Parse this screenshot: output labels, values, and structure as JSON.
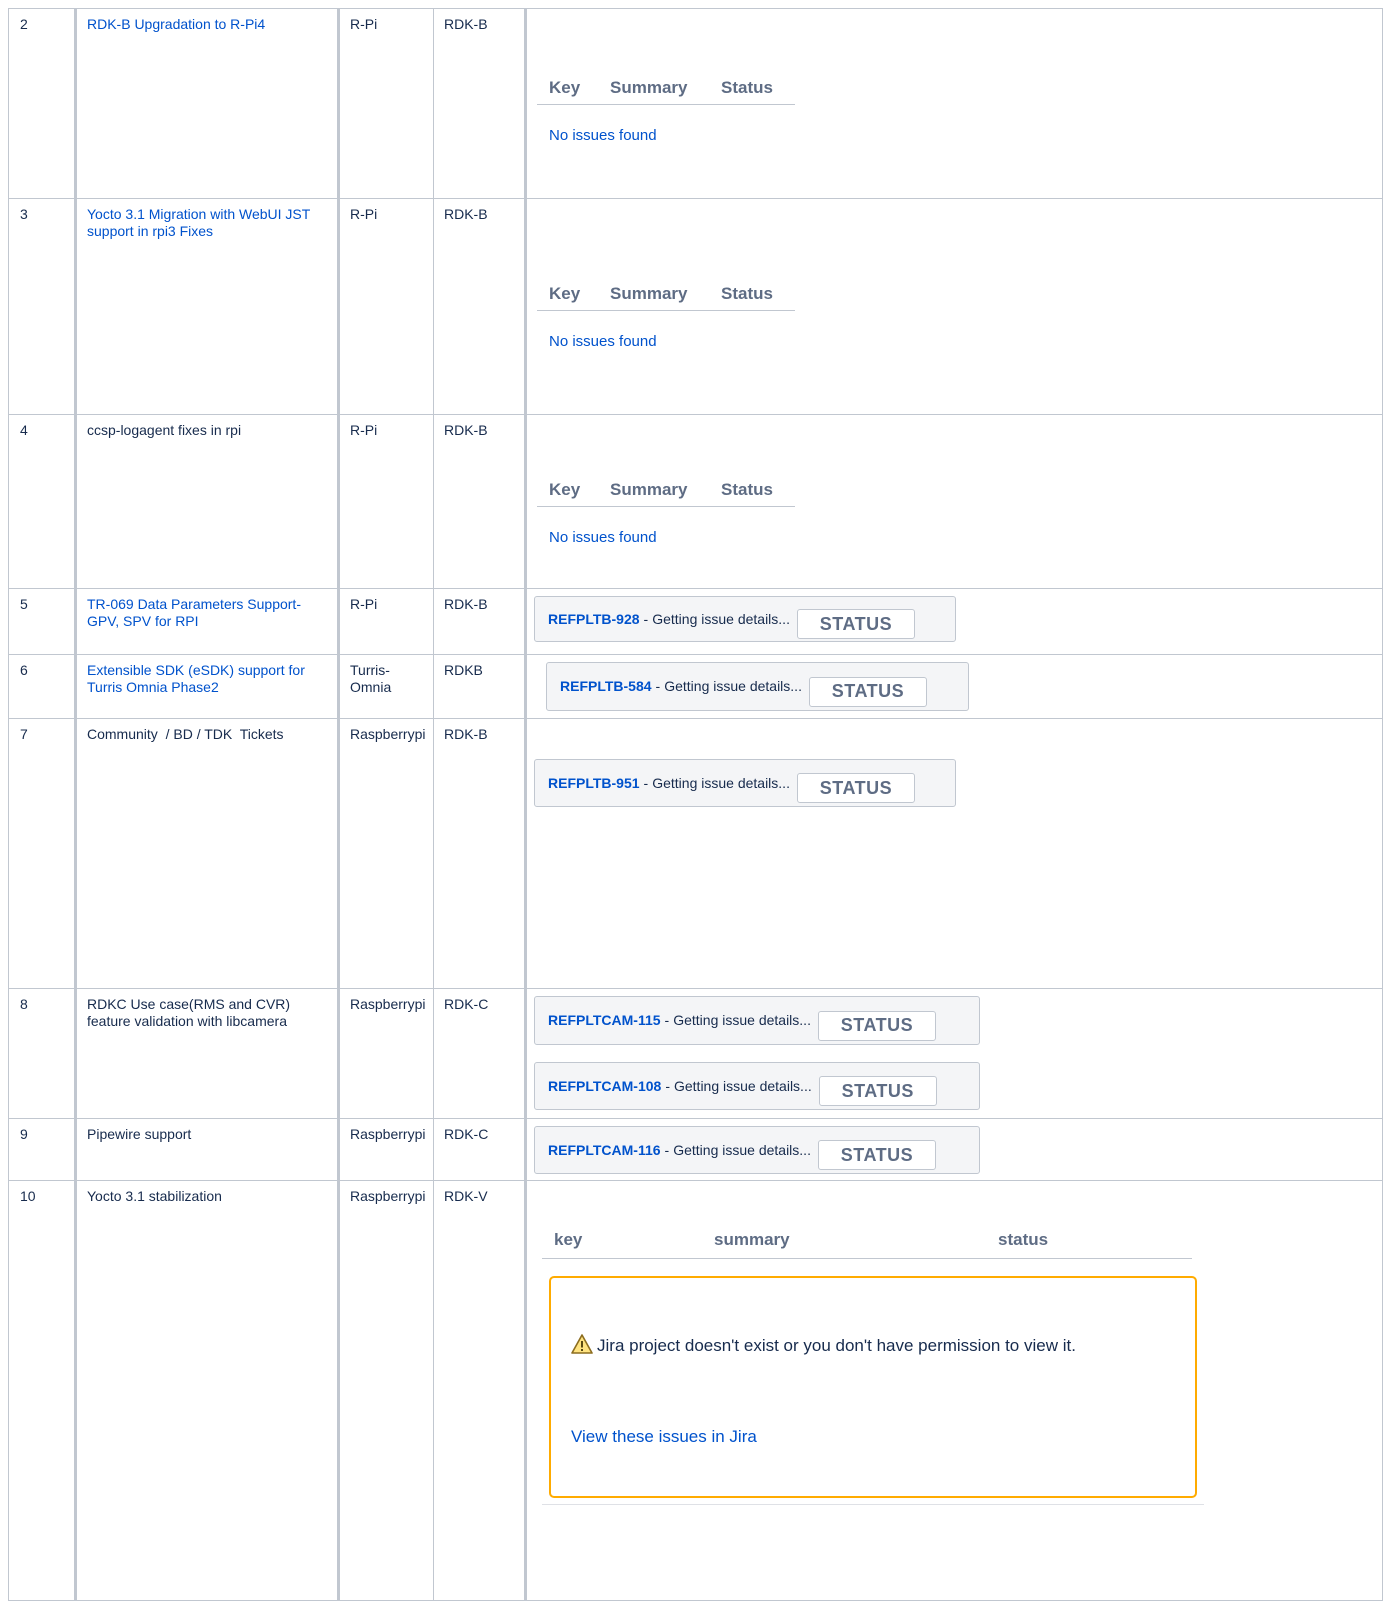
{
  "headers_summary": {
    "key": "Key",
    "summary": "Summary",
    "status": "Status",
    "no_issues": "No issues found"
  },
  "rows": [
    {
      "num": "2",
      "feature": "RDK-B Upgradation to R-Pi4",
      "device": "R-Pi",
      "platform": "RDK-B"
    },
    {
      "num": "3",
      "feature": "Yocto 3.1 Migration with WebUI JST support in rpi3 Fixes",
      "device": "R-Pi",
      "platform": "RDK-B"
    },
    {
      "num": "4",
      "feature": "ccsp-logagent fixes in rpi",
      "device": "R-Pi",
      "platform": "RDK-B"
    },
    {
      "num": "5",
      "feature": "TR-069 Data Parameters Support-GPV, SPV for RPI",
      "device": "R-Pi",
      "platform": "RDK-B",
      "issues": [
        {
          "key": "REFPLTB-928",
          "detail": "Getting issue details...",
          "status": "STATUS"
        }
      ]
    },
    {
      "num": "6",
      "feature": "Extensible SDK (eSDK) support for Turris Omnia Phase2",
      "device": "Turris-Omnia",
      "platform": "RDKB",
      "issues": [
        {
          "key": "REFPLTB-584",
          "detail": "Getting issue details...",
          "status": "STATUS"
        }
      ]
    },
    {
      "num": "7",
      "feature": "Community  / BD / TDK  Tickets",
      "device": "Raspberrypi",
      "platform": "RDK-B",
      "issues": [
        {
          "key": "REFPLTB-951",
          "detail": "Getting issue details...",
          "status": "STATUS"
        }
      ]
    },
    {
      "num": "8",
      "feature": "RDKC Use case(RMS and CVR) feature validation with libcamera",
      "device": "Raspberrypi",
      "platform": "RDK-C",
      "issues": [
        {
          "key": "REFPLTCAM-115",
          "detail": "Getting issue details...",
          "status": "STATUS"
        },
        {
          "key": "REFPLTCAM-108",
          "detail": "Getting issue details...",
          "status": "STATUS"
        }
      ]
    },
    {
      "num": "9",
      "feature": "Pipewire support",
      "device": "Raspberrypi",
      "platform": "RDK-C",
      "issues": [
        {
          "key": "REFPLTCAM-116",
          "detail": "Getting issue details...",
          "status": "STATUS"
        }
      ]
    },
    {
      "num": "10",
      "feature": "Yocto 3.1 stabilization",
      "device": "Raspberrypi",
      "platform": "RDK-V"
    }
  ],
  "jira_error": {
    "col_key": "key",
    "col_summary": "summary",
    "col_status": "status",
    "message": "Jira project doesn't exist or you don't have permission to view it.",
    "link": "View these issues in Jira"
  },
  "colors": {
    "link": "#0052cc",
    "warning_border": "#ffab00",
    "grid": "#c1c7d0"
  },
  "icons": {
    "warning": "warning-triangle-icon"
  }
}
